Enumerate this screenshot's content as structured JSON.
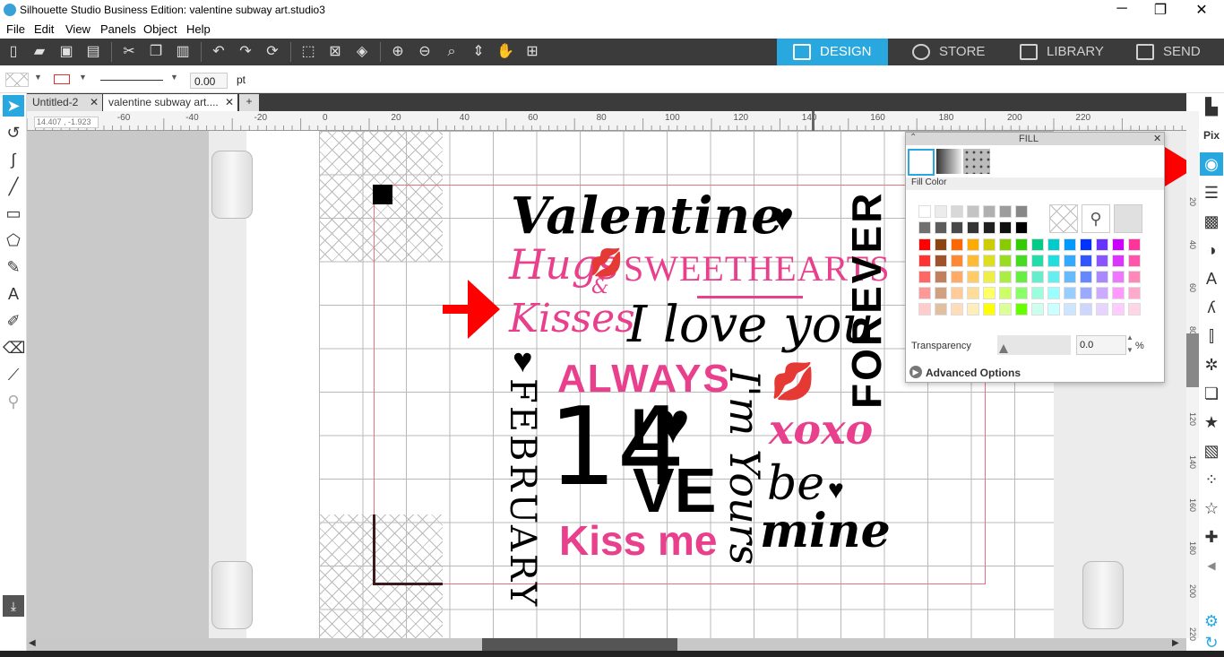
{
  "window": {
    "title": "Silhouette Studio Business Edition: valentine subway art.studio3",
    "minimize": "─",
    "restore": "❐",
    "close": "✕"
  },
  "menu": [
    "File",
    "Edit",
    "View",
    "Panels",
    "Object",
    "Help"
  ],
  "nav_tabs": [
    {
      "label": "DESIGN"
    },
    {
      "label": "STORE"
    },
    {
      "label": "LIBRARY"
    },
    {
      "label": "SEND"
    }
  ],
  "props": {
    "line_width": "0.00",
    "unit": "pt"
  },
  "doc_tabs": [
    {
      "label": "Untitled-2"
    },
    {
      "label": "valentine subway art...."
    }
  ],
  "coords": "14.407 , -1.923",
  "ruler_top": [
    "-60",
    "-40",
    "-20",
    "0",
    "20",
    "40",
    "60",
    "80",
    "100",
    "120",
    "140",
    "160",
    "180",
    "200",
    "220"
  ],
  "ruler_left": [
    "20",
    "40",
    "60",
    "80",
    "100",
    "120",
    "140",
    "160",
    "180",
    "200",
    "220"
  ],
  "artwork": {
    "valentine": "Valentine",
    "hugs": "Hugs",
    "amp": "&",
    "kisses": "Kisses",
    "sweethearts": "SWEETHEARTS",
    "iloveyou": "I love you",
    "forever": "FOREVER",
    "always": "ALWAYS",
    "february": "FEBRUARY",
    "fourteen": "14",
    "l": "L",
    "ve": "VE",
    "imyours": "I'm Yours",
    "xoxo": "xoxo",
    "be": "be",
    "mine": "mine",
    "kissme": "Kiss me"
  },
  "fill_panel": {
    "title": "FILL",
    "section": "Fill Color",
    "transparency_label": "Transparency",
    "transparency_value": "0.0",
    "percent": "%",
    "advanced": "Advanced Options"
  },
  "colors": {
    "pink": "#e8408c",
    "accent": "#29a8e0",
    "arrow": "#ff0000"
  }
}
